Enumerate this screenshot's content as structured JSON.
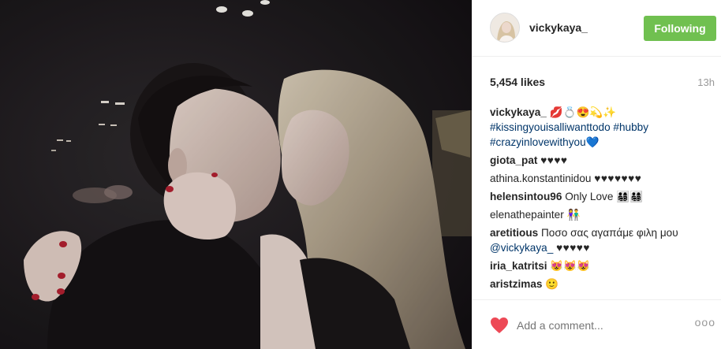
{
  "post": {
    "username": "vickykaya_",
    "follow_label": "Following",
    "likes": "5,454 likes",
    "time": "13h",
    "caption": {
      "author": "vickykaya_",
      "emojis": "💋💍😍💫✨",
      "hashtag1": "#kissingyouisalliwanttodo",
      "hashtag2": "#hubby",
      "hashtag3": "#crazyinlovewithyou",
      "heart": "💙"
    }
  },
  "comments": [
    {
      "author": "giota_pat",
      "text": "♥♥♥♥"
    },
    {
      "author": "athina.konstantinidou",
      "text": "♥♥♥♥♥♥♥"
    },
    {
      "author": "helensintou96",
      "text": "Only Love 👨‍👩‍👧‍👦👨‍👩‍👧‍👦"
    },
    {
      "author": "elenathepainter",
      "text": "👫"
    },
    {
      "author": "aretitious",
      "text": "Ποσο σας αγαπάμε φιλη μου",
      "mention": "@vickykaya_",
      "text2": "♥♥♥♥♥"
    },
    {
      "author": "iria_katritsi",
      "text": "😻😻😻"
    },
    {
      "author": "aristzimas",
      "text": "🙂"
    }
  ],
  "footer": {
    "add_comment_placeholder": "Add a comment...",
    "more_label": "ooo"
  }
}
